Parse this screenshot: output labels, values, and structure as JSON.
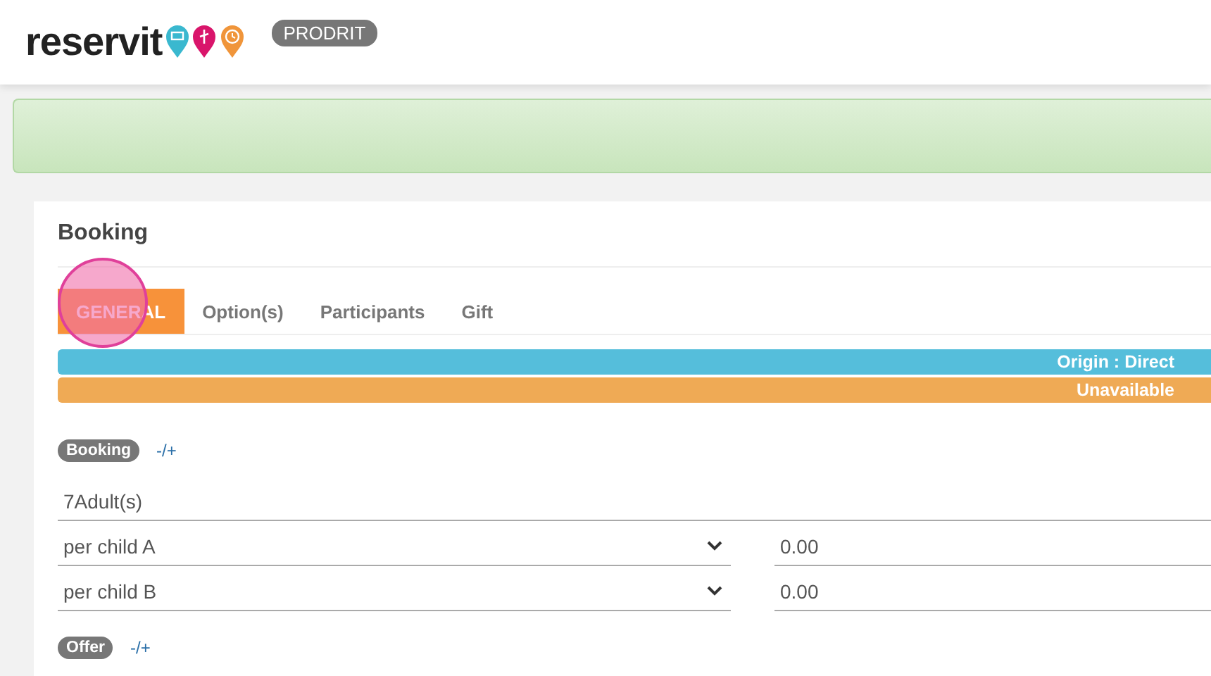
{
  "header": {
    "logo_text": "reservit",
    "environment_badge": "PRODRIT"
  },
  "alert": {
    "kind": "success"
  },
  "card": {
    "title": "Booking",
    "tabs": [
      {
        "label": "GENERAL",
        "selected": true
      },
      {
        "label": "Option(s)",
        "selected": false
      },
      {
        "label": "Participants",
        "selected": false
      },
      {
        "label": "Gift",
        "selected": false
      }
    ],
    "click_indicator": true,
    "status_bars": [
      {
        "text": "Origin : Direct",
        "color": "#55bedb"
      },
      {
        "text": "Unavailable",
        "color": "#efaa55"
      }
    ],
    "sections": [
      {
        "label": "Booking",
        "toggle": "-/+"
      }
    ],
    "adults_field": {
      "value": "7Adult(s)"
    },
    "child_rows": [
      {
        "select": "per child A",
        "amount": "0.00"
      },
      {
        "select": "per child B",
        "amount": "0.00"
      }
    ],
    "offer_section": {
      "label": "Offer",
      "toggle": "-/+"
    }
  }
}
